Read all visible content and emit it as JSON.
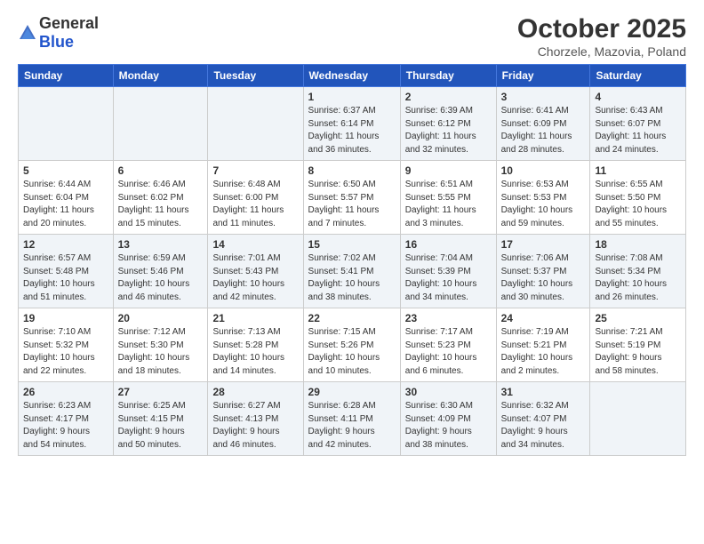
{
  "logo": {
    "general": "General",
    "blue": "Blue"
  },
  "title": "October 2025",
  "location": "Chorzele, Mazovia, Poland",
  "days_of_week": [
    "Sunday",
    "Monday",
    "Tuesday",
    "Wednesday",
    "Thursday",
    "Friday",
    "Saturday"
  ],
  "weeks": [
    [
      {
        "day": "",
        "info": ""
      },
      {
        "day": "",
        "info": ""
      },
      {
        "day": "",
        "info": ""
      },
      {
        "day": "1",
        "info": "Sunrise: 6:37 AM\nSunset: 6:14 PM\nDaylight: 11 hours\nand 36 minutes."
      },
      {
        "day": "2",
        "info": "Sunrise: 6:39 AM\nSunset: 6:12 PM\nDaylight: 11 hours\nand 32 minutes."
      },
      {
        "day": "3",
        "info": "Sunrise: 6:41 AM\nSunset: 6:09 PM\nDaylight: 11 hours\nand 28 minutes."
      },
      {
        "day": "4",
        "info": "Sunrise: 6:43 AM\nSunset: 6:07 PM\nDaylight: 11 hours\nand 24 minutes."
      }
    ],
    [
      {
        "day": "5",
        "info": "Sunrise: 6:44 AM\nSunset: 6:04 PM\nDaylight: 11 hours\nand 20 minutes."
      },
      {
        "day": "6",
        "info": "Sunrise: 6:46 AM\nSunset: 6:02 PM\nDaylight: 11 hours\nand 15 minutes."
      },
      {
        "day": "7",
        "info": "Sunrise: 6:48 AM\nSunset: 6:00 PM\nDaylight: 11 hours\nand 11 minutes."
      },
      {
        "day": "8",
        "info": "Sunrise: 6:50 AM\nSunset: 5:57 PM\nDaylight: 11 hours\nand 7 minutes."
      },
      {
        "day": "9",
        "info": "Sunrise: 6:51 AM\nSunset: 5:55 PM\nDaylight: 11 hours\nand 3 minutes."
      },
      {
        "day": "10",
        "info": "Sunrise: 6:53 AM\nSunset: 5:53 PM\nDaylight: 10 hours\nand 59 minutes."
      },
      {
        "day": "11",
        "info": "Sunrise: 6:55 AM\nSunset: 5:50 PM\nDaylight: 10 hours\nand 55 minutes."
      }
    ],
    [
      {
        "day": "12",
        "info": "Sunrise: 6:57 AM\nSunset: 5:48 PM\nDaylight: 10 hours\nand 51 minutes."
      },
      {
        "day": "13",
        "info": "Sunrise: 6:59 AM\nSunset: 5:46 PM\nDaylight: 10 hours\nand 46 minutes."
      },
      {
        "day": "14",
        "info": "Sunrise: 7:01 AM\nSunset: 5:43 PM\nDaylight: 10 hours\nand 42 minutes."
      },
      {
        "day": "15",
        "info": "Sunrise: 7:02 AM\nSunset: 5:41 PM\nDaylight: 10 hours\nand 38 minutes."
      },
      {
        "day": "16",
        "info": "Sunrise: 7:04 AM\nSunset: 5:39 PM\nDaylight: 10 hours\nand 34 minutes."
      },
      {
        "day": "17",
        "info": "Sunrise: 7:06 AM\nSunset: 5:37 PM\nDaylight: 10 hours\nand 30 minutes."
      },
      {
        "day": "18",
        "info": "Sunrise: 7:08 AM\nSunset: 5:34 PM\nDaylight: 10 hours\nand 26 minutes."
      }
    ],
    [
      {
        "day": "19",
        "info": "Sunrise: 7:10 AM\nSunset: 5:32 PM\nDaylight: 10 hours\nand 22 minutes."
      },
      {
        "day": "20",
        "info": "Sunrise: 7:12 AM\nSunset: 5:30 PM\nDaylight: 10 hours\nand 18 minutes."
      },
      {
        "day": "21",
        "info": "Sunrise: 7:13 AM\nSunset: 5:28 PM\nDaylight: 10 hours\nand 14 minutes."
      },
      {
        "day": "22",
        "info": "Sunrise: 7:15 AM\nSunset: 5:26 PM\nDaylight: 10 hours\nand 10 minutes."
      },
      {
        "day": "23",
        "info": "Sunrise: 7:17 AM\nSunset: 5:23 PM\nDaylight: 10 hours\nand 6 minutes."
      },
      {
        "day": "24",
        "info": "Sunrise: 7:19 AM\nSunset: 5:21 PM\nDaylight: 10 hours\nand 2 minutes."
      },
      {
        "day": "25",
        "info": "Sunrise: 7:21 AM\nSunset: 5:19 PM\nDaylight: 9 hours\nand 58 minutes."
      }
    ],
    [
      {
        "day": "26",
        "info": "Sunrise: 6:23 AM\nSunset: 4:17 PM\nDaylight: 9 hours\nand 54 minutes."
      },
      {
        "day": "27",
        "info": "Sunrise: 6:25 AM\nSunset: 4:15 PM\nDaylight: 9 hours\nand 50 minutes."
      },
      {
        "day": "28",
        "info": "Sunrise: 6:27 AM\nSunset: 4:13 PM\nDaylight: 9 hours\nand 46 minutes."
      },
      {
        "day": "29",
        "info": "Sunrise: 6:28 AM\nSunset: 4:11 PM\nDaylight: 9 hours\nand 42 minutes."
      },
      {
        "day": "30",
        "info": "Sunrise: 6:30 AM\nSunset: 4:09 PM\nDaylight: 9 hours\nand 38 minutes."
      },
      {
        "day": "31",
        "info": "Sunrise: 6:32 AM\nSunset: 4:07 PM\nDaylight: 9 hours\nand 34 minutes."
      },
      {
        "day": "",
        "info": ""
      }
    ]
  ]
}
